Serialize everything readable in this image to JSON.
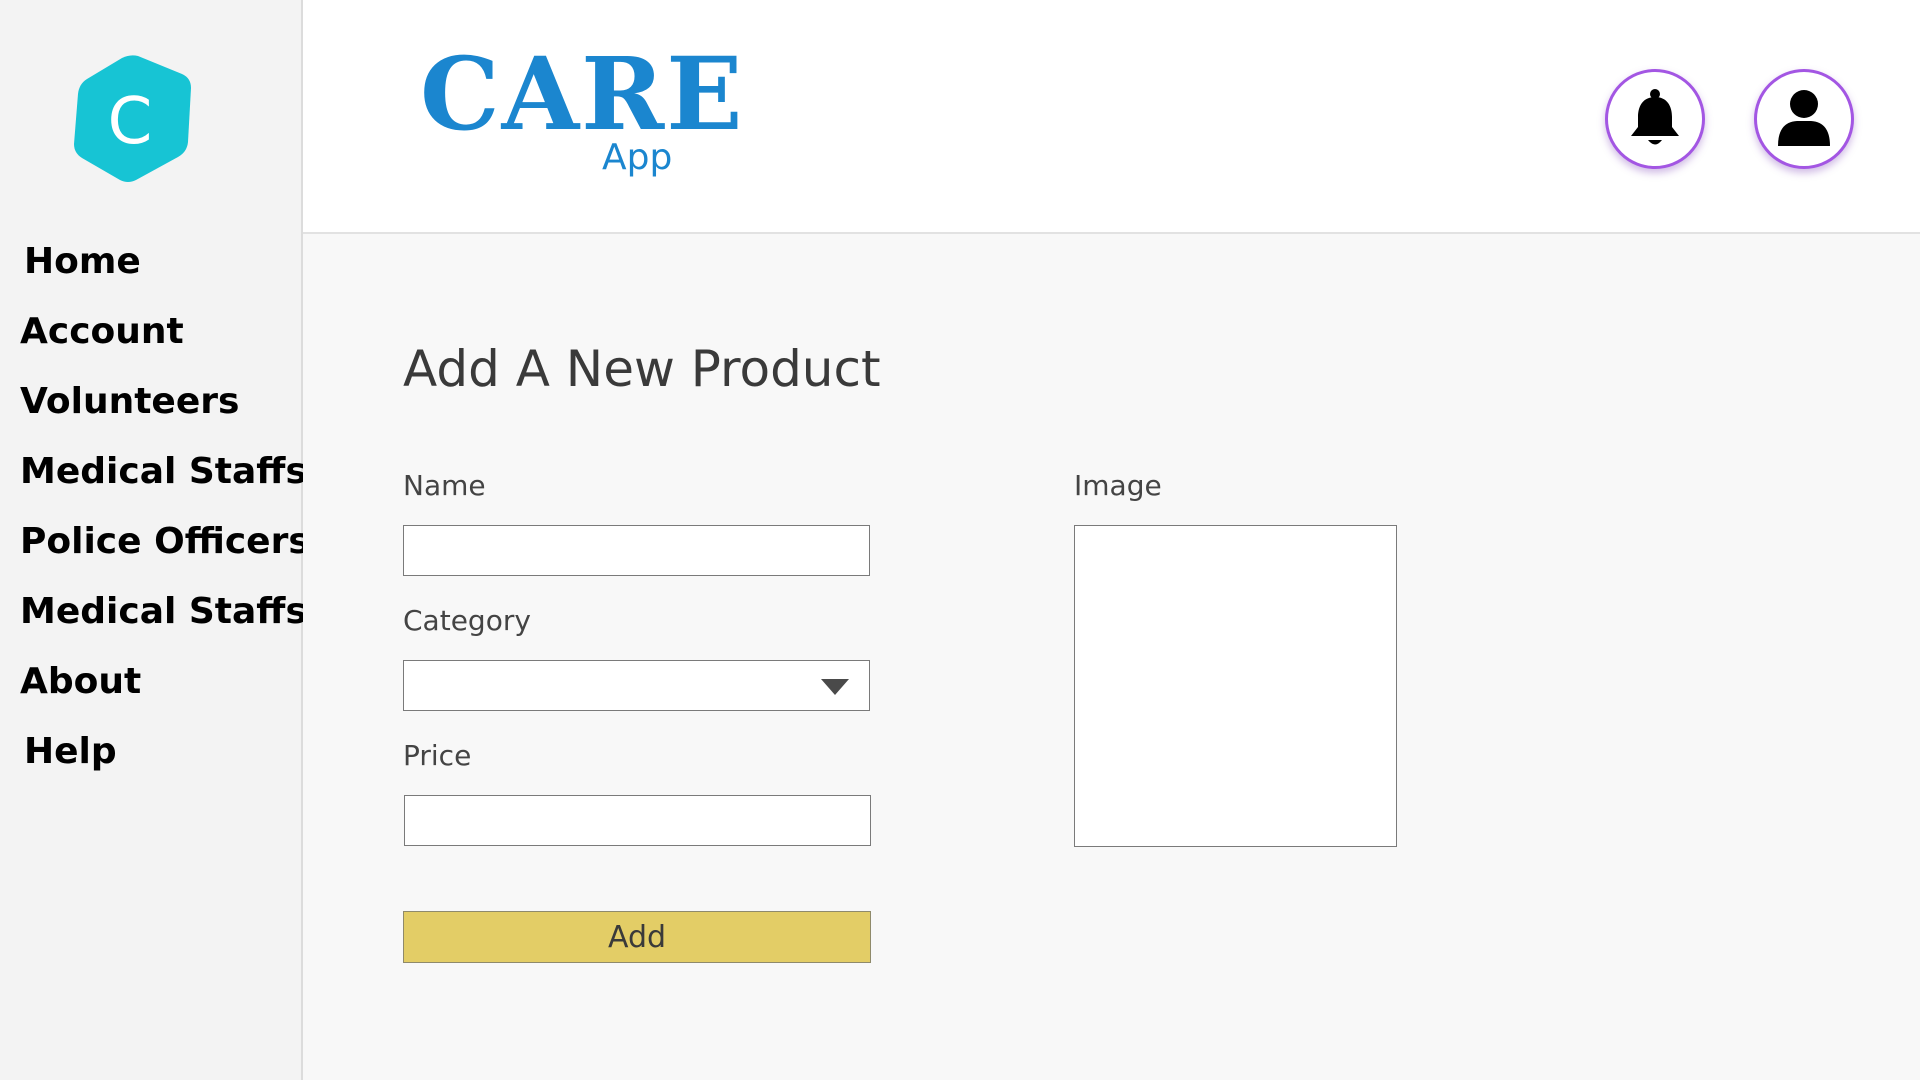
{
  "app": {
    "logo_letter": "C",
    "brand_title": "CARE",
    "brand_subtitle": "App",
    "accent_color": "#1b86cf",
    "logo_color": "#17c4d4"
  },
  "sidebar": {
    "items": [
      {
        "label": "Home"
      },
      {
        "label": "Account"
      },
      {
        "label": "Volunteers"
      },
      {
        "label": "Medical Staffs"
      },
      {
        "label": "Police Officers"
      },
      {
        "label": "Medical Staffs"
      },
      {
        "label": "About"
      },
      {
        "label": "Help"
      }
    ]
  },
  "header": {
    "icons": [
      "bell-icon",
      "user-icon"
    ]
  },
  "form": {
    "title": "Add A New Product",
    "name_label": "Name",
    "name_value": "",
    "category_label": "Category",
    "category_value": "",
    "price_label": "Price",
    "price_value": "",
    "image_label": "Image",
    "submit_label": "Add",
    "submit_color": "#e3cd66"
  }
}
